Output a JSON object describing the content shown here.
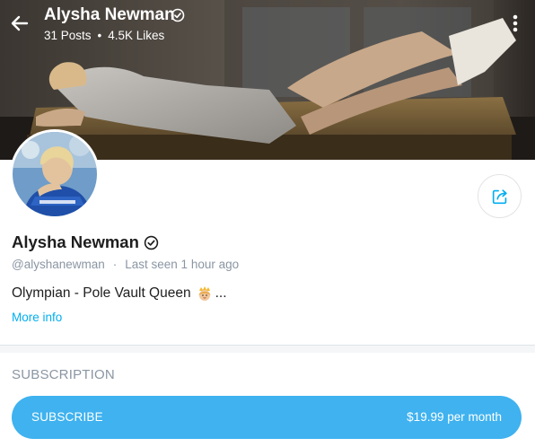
{
  "header": {
    "name": "Alysha Newman",
    "posts": "31 Posts",
    "separator": "•",
    "likes": "4.5K Likes"
  },
  "profile": {
    "name": "Alysha Newman",
    "handle": "@alyshanewman",
    "separator": "·",
    "last_seen": "Last seen 1 hour ago",
    "bio": "Olympian - Pole Vault Queen",
    "bio_emoji": "princess-emoji",
    "bio_ellipsis": "...",
    "more_info": "More info"
  },
  "subscription": {
    "heading": "SUBSCRIPTION",
    "button_label": "SUBSCRIBE",
    "price": "$19.99 per month"
  },
  "colors": {
    "accent": "#00aff0",
    "button": "#3fb2ef",
    "muted": "#8a96a3"
  },
  "icons": [
    "back-arrow-icon",
    "verified-icon",
    "more-vertical-icon",
    "share-icon"
  ]
}
